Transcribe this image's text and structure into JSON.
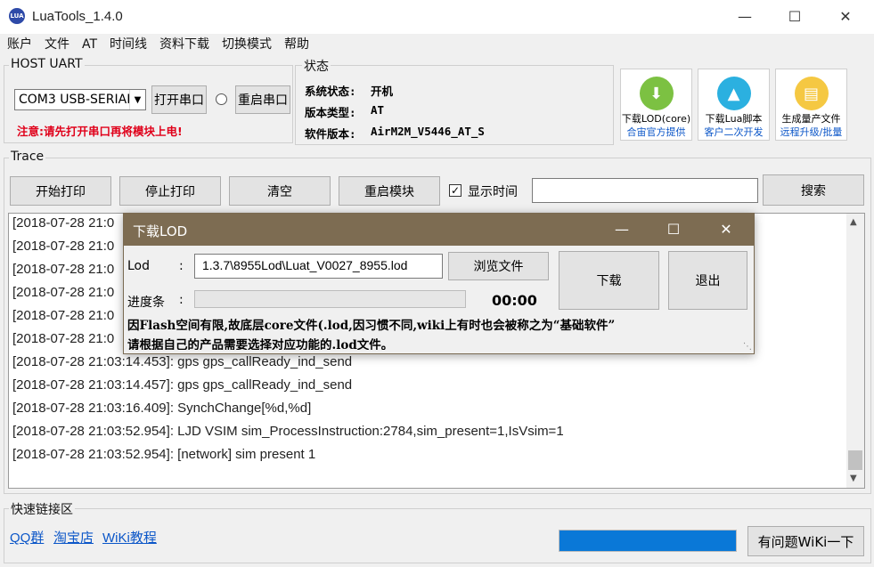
{
  "window": {
    "title": "LuaTools_1.4.0",
    "icon_text": "LUA"
  },
  "menu": [
    "账户",
    "文件",
    "AT",
    "时间线",
    "资料下载",
    "切换模式",
    "帮助"
  ],
  "host_uart": {
    "label": "HOST UART",
    "port_value": "COM3 USB-SERIAL",
    "open_label": "打开串口",
    "restart_label": "重启串口",
    "warning": "注意:请先打开串口再将模块上电!"
  },
  "status": {
    "label": "状态",
    "rows": [
      {
        "key": "系统状态:",
        "value": "开机"
      },
      {
        "key": "版本类型:",
        "value": "AT"
      },
      {
        "key": "软件版本:",
        "value": "AirM2M_V5446_AT_S"
      }
    ]
  },
  "tools": [
    {
      "line1": "下载LOD(core)",
      "line2": "合宙官方提供",
      "icon": "download-arrow-icon",
      "color": "#7cc142"
    },
    {
      "line1": "下载Lua脚本",
      "line2": "客户二次开发",
      "icon": "script-upload-icon",
      "color": "#2bb0e0"
    },
    {
      "line1": "生成量产文件",
      "line2": "远程升级/批量",
      "icon": "document-icon",
      "color": "#f5c842"
    }
  ],
  "trace": {
    "label": "Trace",
    "start_label": "开始打印",
    "stop_label": "停止打印",
    "clear_label": "清空",
    "restart_module_label": "重启模块",
    "show_time_label": "显示时间",
    "show_time_checked": "✓",
    "search_value": "",
    "search_label": "搜索",
    "log": [
      "[2018-07-28 21:0",
      "[2018-07-28 21:0",
      "[2018-07-28 21:0",
      "[2018-07-28 21:0",
      "[2018-07-28 21:0",
      "[2018-07-28 21:0",
      "[2018-07-28 21:03:14.453]: gps gps_callReady_ind_send",
      "[2018-07-28 21:03:14.457]: gps gps_callReady_ind_send",
      "[2018-07-28 21:03:16.409]: SynchChange[%d,%d]",
      "[2018-07-28 21:03:52.954]: LJD VSIM sim_ProcessInstruction:2784,sim_present=1,IsVsim=1",
      "[2018-07-28 21:03:52.954]: [network] sim present 1"
    ]
  },
  "quick_links": {
    "label": "快速链接区",
    "links": [
      "QQ群",
      "淘宝店",
      "WiKi教程"
    ],
    "wiki_button": "有问题WiKi一下",
    "progress_fraction": 1.0
  },
  "dialog": {
    "title": "下载LOD",
    "lod_label": "Lod",
    "colon": ":",
    "lod_path": "1.3.7\\8955Lod\\Luat_V0027_8955.lod",
    "browse_label": "浏览文件",
    "progress_label": "进度条",
    "progress_fraction": 0,
    "time": "00:00",
    "download_label": "下载",
    "exit_label": "退出",
    "note_line1": "因Flash空间有限,故底层core文件(.lod,因习惯不同,wiki上有时也会被称之为“基础软件”",
    "note_line2": "请根据自己的产品需要选择对应功能的.lod文件。"
  },
  "colors": {
    "dialog_title": "#7d6c52",
    "progress": "#0a78d7",
    "link": "#0b56c8"
  }
}
